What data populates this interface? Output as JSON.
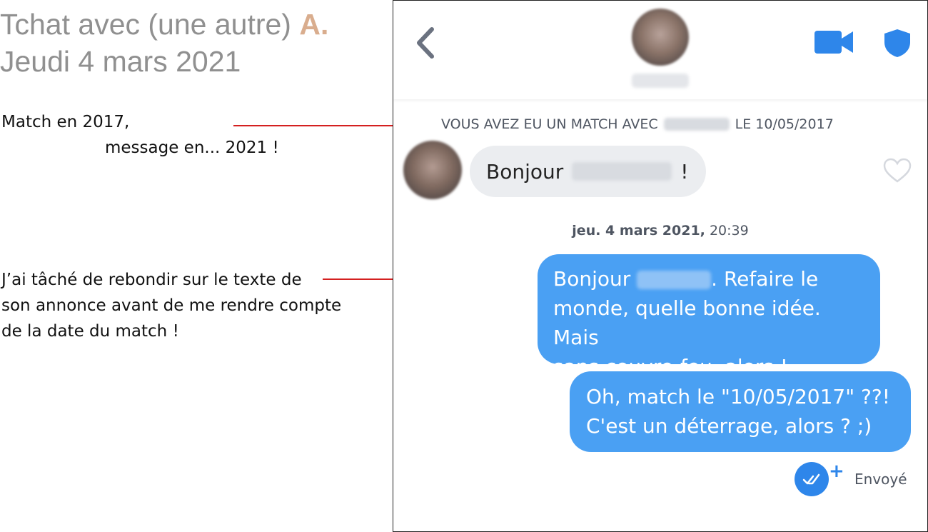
{
  "annotation": {
    "title_text": "Tchat avec (une autre) ",
    "title_initial": "A.",
    "title_date": "Jeudi 4 mars 2021",
    "note_match_line1": "Match en 2017,",
    "note_match_line2": "message en... 2021 !",
    "note_rebound_line1": "J’ai tâché de rebondir sur le texte de",
    "note_rebound_line2": "son annonce avant de me rendre compte",
    "note_rebound_line3": "de la date du match !"
  },
  "chat": {
    "match_prefix": "VOUS AVEZ EU UN MATCH AVEC",
    "match_suffix": "LE 10/05/2017",
    "received_greeting": "Bonjour",
    "received_end": "!",
    "date_bold": "jeu. 4 mars 2021,",
    "date_time": " 20:39",
    "sent1_start": "Bonjour",
    "sent1_rest_line1": ". Refaire le",
    "sent1_line2": "monde, quelle bonne idée. Mais",
    "sent1_line3": "sans couvre-feu, alors !",
    "sent2_line1": "Oh, match le \"10/05/2017\" ??!",
    "sent2_line2": "C'est un déterrage, alors ? ;)",
    "status_plus": "+",
    "status_label": "Envoyé"
  },
  "icons": {
    "back": "chevron-left-icon",
    "video": "video-camera-icon",
    "shield": "shield-icon",
    "like": "heart-icon",
    "read": "double-check-icon"
  },
  "colors": {
    "accent_blue": "#4aa0f3",
    "status_blue": "#2e86ea",
    "callout_red": "#d42020",
    "initial_accent": "#d9ad8e"
  }
}
